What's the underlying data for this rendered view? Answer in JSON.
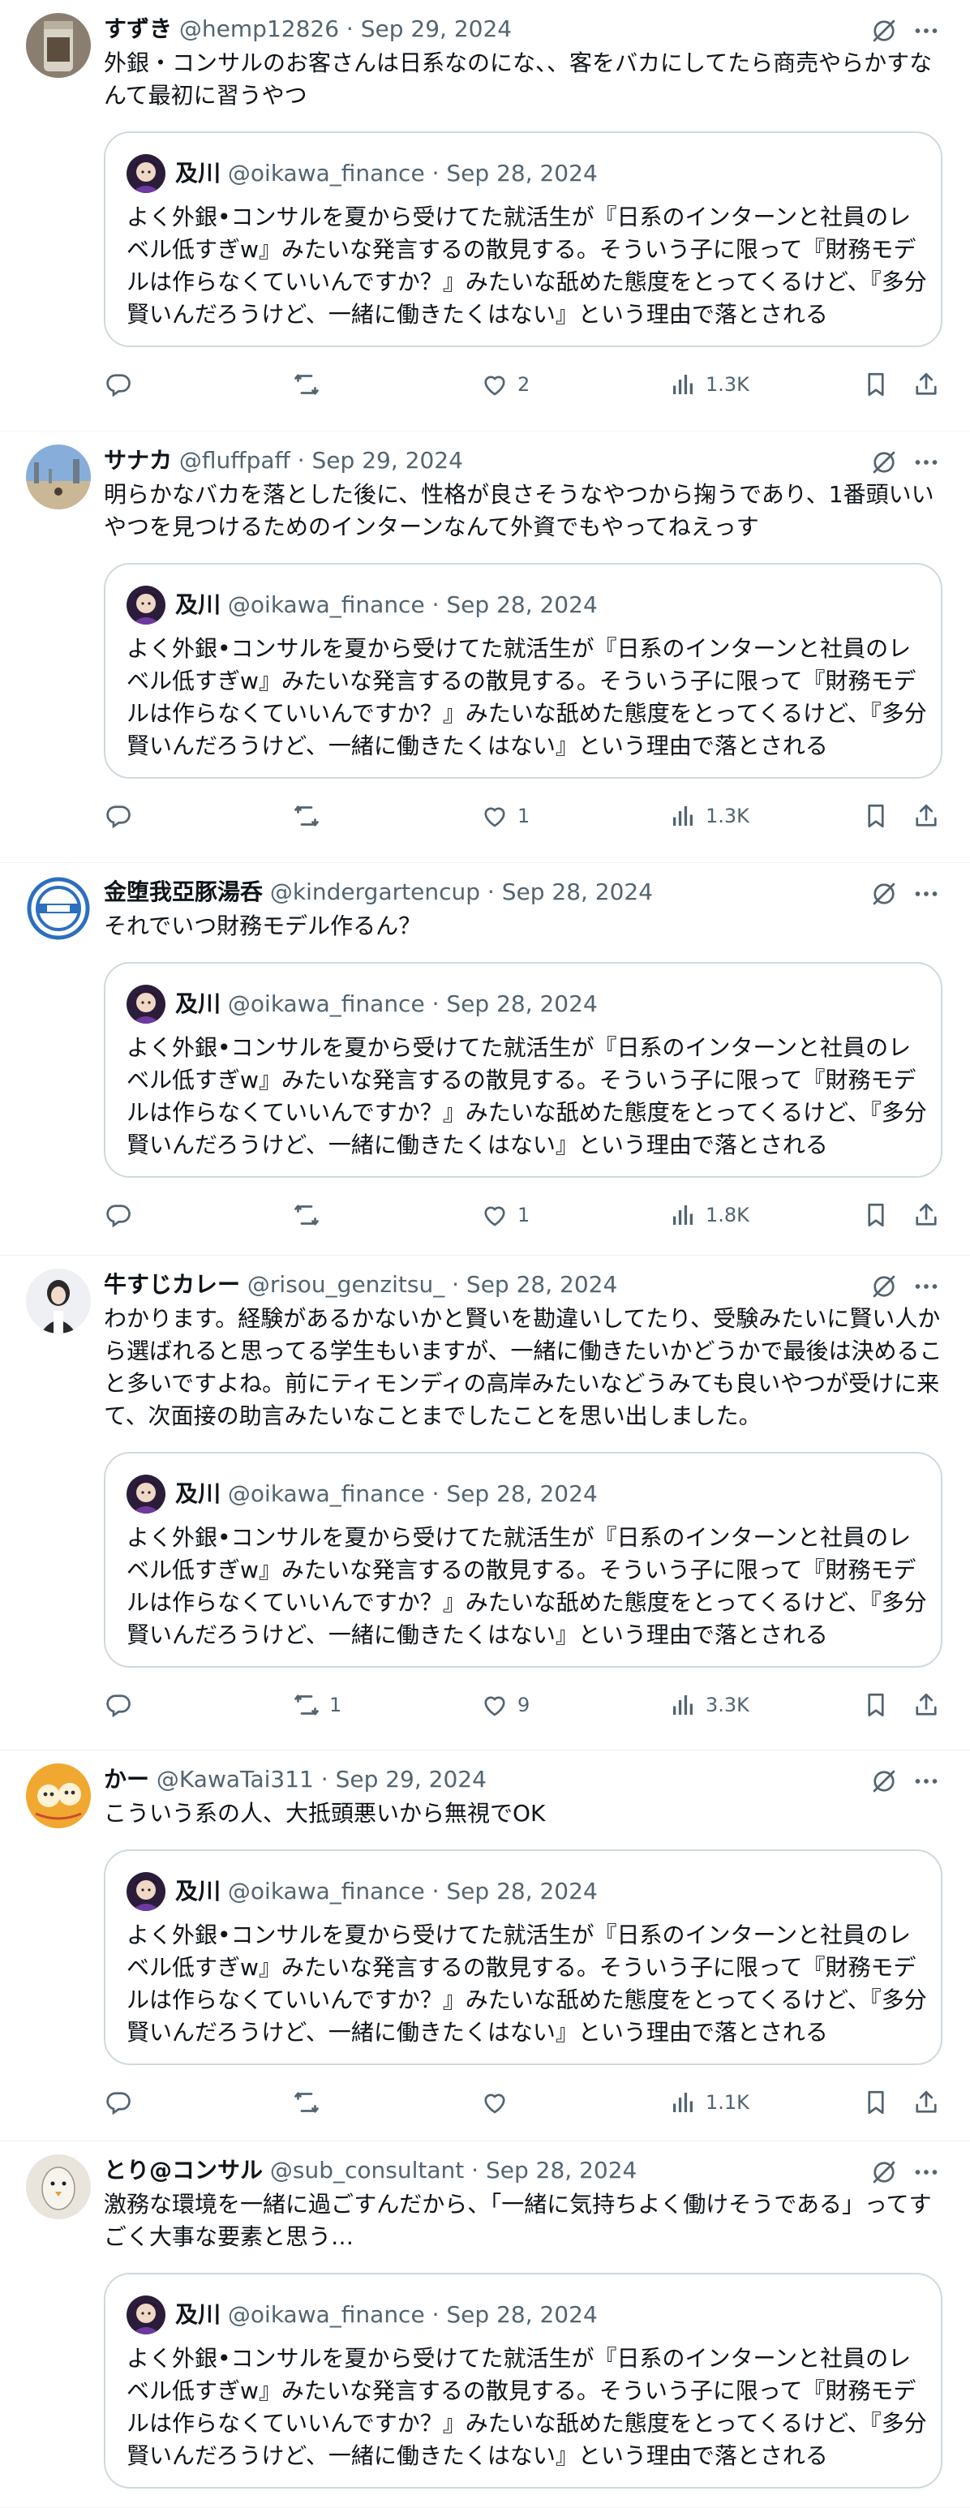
{
  "quoted": {
    "name": "及川",
    "handle": "@oikawa_finance",
    "date": "Sep 28, 2024",
    "text": "よく外銀•コンサルを夏から受けてた就活生が『日系のインターンと社員のレベル低すぎw』みたいな発言するの散見する。そういう子に限って『財務モデルは作らなくていいんですか？』みたいな舐めた態度をとってくるけど、『多分賢いんだろうけど、一緒に働きたくはない』という理由で落とされる"
  },
  "tweets": [
    {
      "name": "すずき",
      "handle": "@hemp12826",
      "date": "Sep 29, 2024",
      "text": "外銀・コンサルのお客さんは日系なのにな、、客をバカにしてたら商売やらかすなんて最初に習うやつ",
      "replies": "",
      "retweets": "",
      "likes": "2",
      "views": "1.3K"
    },
    {
      "name": "サナカ",
      "handle": "@fluffpaff",
      "date": "Sep 29, 2024",
      "text": "明らかなバカを落とした後に、性格が良さそうなやつから掬うであり、1番頭いいやつを見つけるためのインターンなんて外資でもやってねえっす",
      "replies": "",
      "retweets": "",
      "likes": "1",
      "views": "1.3K"
    },
    {
      "name": "金堕我亞豚湯呑",
      "handle": "@kindergartencup",
      "date": "Sep 28, 2024",
      "text": "それでいつ財務モデル作るん？",
      "replies": "",
      "retweets": "",
      "likes": "1",
      "views": "1.8K"
    },
    {
      "name": "牛すじカレー",
      "handle": "@risou_genzitsu_",
      "date": "Sep 28, 2024",
      "text": "わかります。経験があるかないかと賢いを勘違いしてたり、受験みたいに賢い人から選ばれると思ってる学生もいますが、一緒に働きたいかどうかで最後は決めること多いですよね。前にティモンディの高岸みたいなどうみても良いやつが受けに来て、次面接の助言みたいなことまでしたことを思い出しました。",
      "replies": "",
      "retweets": "1",
      "likes": "9",
      "views": "3.3K"
    },
    {
      "name": "かー",
      "handle": "@KawaTai311",
      "date": "Sep 29, 2024",
      "text": "こういう系の人、大抵頭悪いから無視でOK",
      "replies": "",
      "retweets": "",
      "likes": "",
      "views": "1.1K"
    },
    {
      "name": "とり@コンサル",
      "handle": "@sub_consultant",
      "date": "Sep 28, 2024",
      "text": "激務な環境を一緒に過ごすんだから、「一緒に気持ちよく働けそうである」ってすごく大事な要素と思う…",
      "replies": "",
      "retweets": "",
      "likes": "",
      "views": ""
    }
  ],
  "separator": " · ",
  "colors": {
    "text": "#0f1419",
    "secondary": "#536471",
    "border": "#eff3f4",
    "quote_border": "#cfd9de"
  }
}
